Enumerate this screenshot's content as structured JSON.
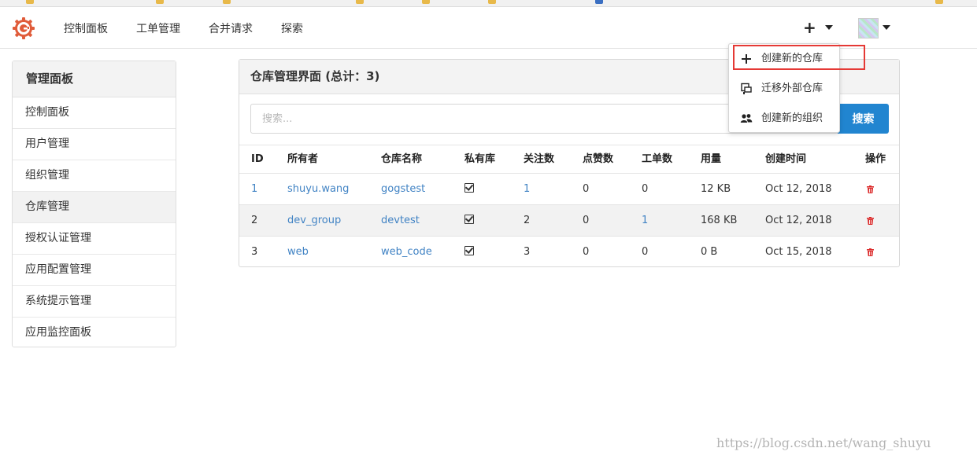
{
  "navbar": {
    "items": [
      {
        "label": "控制面板"
      },
      {
        "label": "工单管理"
      },
      {
        "label": "合并请求"
      },
      {
        "label": "探索"
      }
    ],
    "plus_label": "+"
  },
  "sidebar": {
    "title": "管理面板",
    "items": [
      {
        "label": "控制面板"
      },
      {
        "label": "用户管理"
      },
      {
        "label": "组织管理"
      },
      {
        "label": "仓库管理",
        "active": true
      },
      {
        "label": "授权认证管理"
      },
      {
        "label": "应用配置管理"
      },
      {
        "label": "系统提示管理"
      },
      {
        "label": "应用监控面板"
      }
    ]
  },
  "panel": {
    "title": "仓库管理界面 (总计：3)",
    "search": {
      "placeholder": "搜索...",
      "button_label": "搜索"
    },
    "table": {
      "headers": [
        "ID",
        "所有者",
        "仓库名称",
        "私有库",
        "关注数",
        "点赞数",
        "工单数",
        "用量",
        "创建时间",
        "操作"
      ],
      "rows": [
        {
          "id": "1",
          "owner": "shuyu.wang",
          "name": "gogstest",
          "private": true,
          "watches": "1",
          "stars": "0",
          "issues": "0",
          "size": "12 KB",
          "created": "Oct 12, 2018"
        },
        {
          "id": "2",
          "owner": "dev_group",
          "name": "devtest",
          "private": true,
          "watches": "2",
          "stars": "0",
          "issues": "1",
          "size": "168 KB",
          "created": "Oct 12, 2018"
        },
        {
          "id": "3",
          "owner": "web",
          "name": "web_code",
          "private": true,
          "watches": "3",
          "stars": "0",
          "issues": "0",
          "size": "0 B",
          "created": "Oct 15, 2018"
        }
      ]
    }
  },
  "dropdown": {
    "items": [
      {
        "label": "创建新的仓库",
        "icon": "plus-icon"
      },
      {
        "label": "迁移外部仓库",
        "icon": "repo-clone-icon"
      },
      {
        "label": "创建新的组织",
        "icon": "organization-icon"
      }
    ]
  },
  "watermark": "https://blog.csdn.net/wang_shuyu",
  "colors": {
    "accent": "#2185d0",
    "link": "#4183c4",
    "delete": "#db2828",
    "highlight": "#e53935",
    "logo": "#e05c3a"
  }
}
